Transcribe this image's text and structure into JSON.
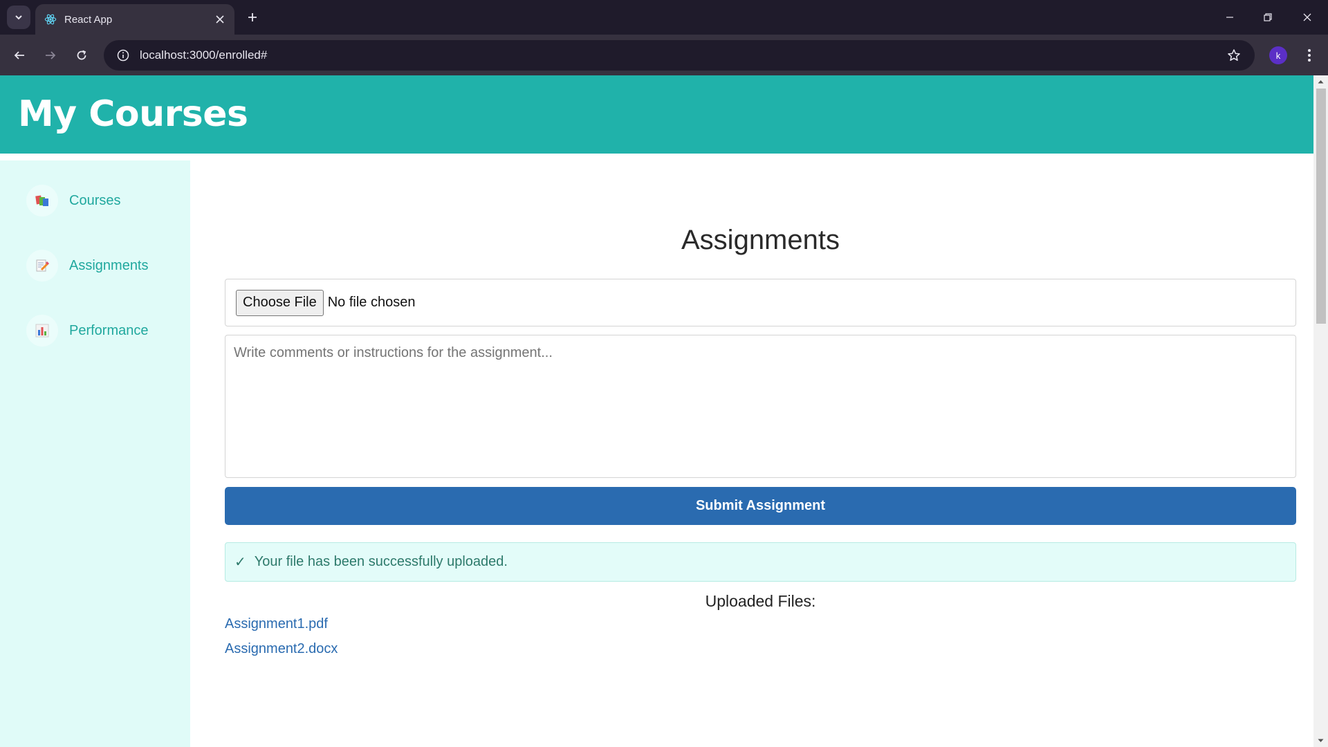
{
  "browser": {
    "tab_title": "React App",
    "url": "localhost:3000/enrolled#",
    "profile_initial": "k"
  },
  "header": {
    "title": "My Courses"
  },
  "sidebar": {
    "items": [
      {
        "label": "Courses",
        "icon": "books-icon"
      },
      {
        "label": "Assignments",
        "icon": "memo-icon"
      },
      {
        "label": "Performance",
        "icon": "bar-chart-icon"
      }
    ]
  },
  "main": {
    "title": "Assignments",
    "file_button": "Choose File",
    "file_status": "No file chosen",
    "comments_placeholder": "Write comments or instructions for the assignment...",
    "submit_label": "Submit Assignment",
    "success_icon": "✓",
    "success_message": "Your file has been successfully uploaded.",
    "uploaded_title": "Uploaded Files:",
    "uploaded_files": [
      "Assignment1.pdf",
      "Assignment2.docx"
    ]
  },
  "colors": {
    "header_bg": "#20b2aa",
    "sidebar_bg": "#e0fbf8",
    "accent_text": "#20a89e",
    "submit_bg": "#2a6bb0",
    "success_bg": "#e3fcf9",
    "link": "#2a6bb0"
  }
}
